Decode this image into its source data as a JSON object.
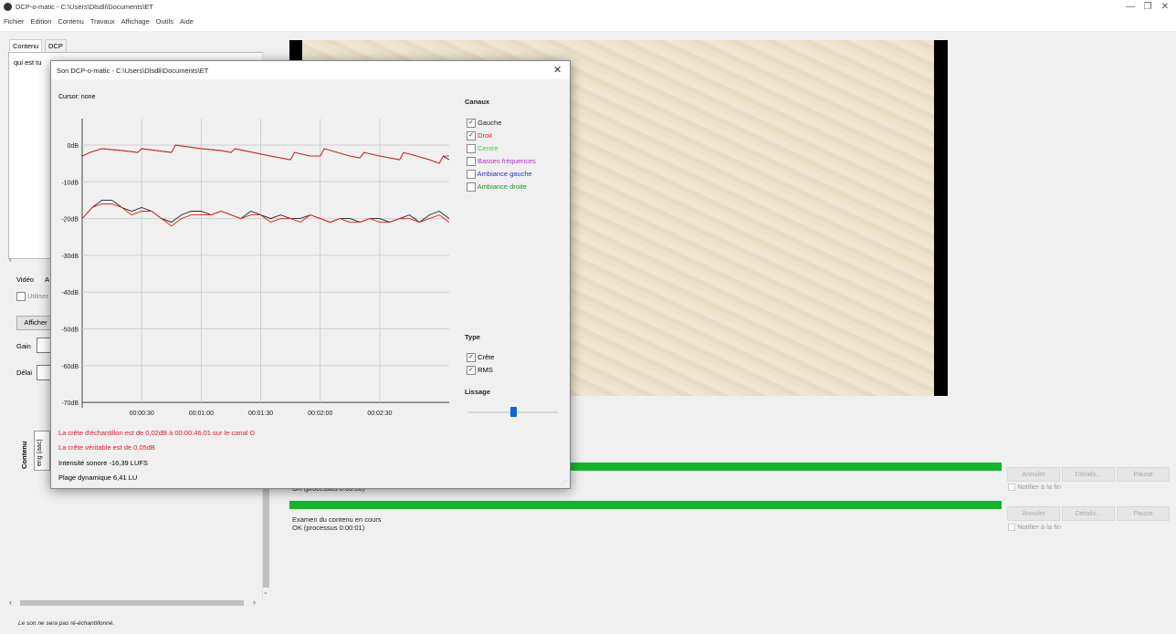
{
  "window": {
    "title": "DCP-o-matic - C:\\Users\\Dlsdli\\Documents\\ET",
    "min": "—",
    "restore": "❐",
    "close": "✕"
  },
  "menu": [
    "Fichier",
    "Edition",
    "Contenu",
    "Travaux",
    "Affichage",
    "Outils",
    "Aide"
  ],
  "left": {
    "tabs": [
      "Contenu",
      "DCP"
    ],
    "content_item": "qui est tu",
    "lower_tabs": [
      "Vidéo",
      "A"
    ],
    "use_label": "Utiliser",
    "show_button": "Afficher",
    "gain_label": "Gain",
    "delay_label": "Délai",
    "vertical_label": "Contenu",
    "track_label": "eng (aac)",
    "footer_note": "Le son ne sera pas ré-échantillonné."
  },
  "jobs": [
    {
      "status": "OK (processus 0:00:50)",
      "cancel": "Annuler",
      "details": "Détails...",
      "pause": "Pause",
      "notify": "Notifier à la fin",
      "progress": 1.0
    },
    {
      "name": "Examen du contenu en cours",
      "status": "OK (processus 0:00:01)",
      "cancel": "Annuler",
      "details": "Détails...",
      "pause": "Pause",
      "notify": "Notifier à la fin",
      "progress": 1.0
    }
  ],
  "dialog": {
    "title": "Son DCP-o-matic - C:\\Users\\Dlsdli\\Documents\\ET",
    "close": "✕",
    "cursor": "Cursor: none",
    "channels_heading": "Canaux",
    "channels": [
      {
        "label": "Gauche",
        "checked": true,
        "color": "#222222"
      },
      {
        "label": "Droit",
        "checked": true,
        "color": "#e02020"
      },
      {
        "label": "Centre",
        "checked": false,
        "color": "#33dd33"
      },
      {
        "label": "Basses fréquences",
        "checked": false,
        "color": "#b030d0"
      },
      {
        "label": "Ambiance gauche",
        "checked": false,
        "color": "#3030d0"
      },
      {
        "label": "Ambiance droite",
        "checked": false,
        "color": "#209020"
      }
    ],
    "type_heading": "Type",
    "types": [
      {
        "label": "Crête",
        "checked": true
      },
      {
        "label": "RMS",
        "checked": true
      }
    ],
    "smoothing_heading": "Lissage",
    "smoothing_value": 0.5,
    "stats": {
      "sample_peak": "La crête d'échantillon est de 0,02dB à 00:00:46.01 sur le canal G",
      "true_peak": "La crête véritable est de 0,05dB",
      "loudness": "Intensité sonore -16,39 LUFS",
      "range": "Plage dynamique 6,41 LU"
    }
  },
  "chart_data": {
    "type": "line",
    "y_ticks": [
      "0dB",
      "-10dB",
      "-20dB",
      "-30dB",
      "-40dB",
      "-50dB",
      "-60dB",
      "-70dB"
    ],
    "x_ticks": [
      "00:00:30",
      "00:01:00",
      "00:01:30",
      "00:02:00",
      "00:02:30"
    ],
    "ylim": [
      -70,
      10
    ],
    "grid": true,
    "series": [
      {
        "name": "Gauche",
        "kind": "peak",
        "color": "#222222",
        "x": [
          0,
          4,
          10,
          20,
          28,
          30,
          45,
          47,
          60,
          70,
          75,
          77,
          95,
          105,
          107,
          115,
          120,
          122,
          135,
          140,
          142,
          150,
          160,
          162,
          175,
          180,
          182,
          185
        ],
        "y": [
          -3,
          -2,
          -1,
          -1.5,
          -2,
          -1,
          -2,
          0,
          -1,
          -1.5,
          -2,
          -1,
          -3,
          -4,
          -2,
          -3,
          -3,
          -1,
          -3,
          -3.5,
          -2,
          -3,
          -4,
          -2,
          -4,
          -5,
          -3,
          -4
        ]
      },
      {
        "name": "Droit",
        "kind": "peak",
        "color": "#e02020",
        "x": [
          0,
          4,
          10,
          20,
          28,
          30,
          45,
          47,
          60,
          70,
          75,
          77,
          95,
          105,
          107,
          115,
          120,
          122,
          135,
          140,
          142,
          150,
          160,
          162,
          175,
          180,
          182,
          185
        ],
        "y": [
          -3,
          -2,
          -1,
          -1.5,
          -2,
          -1,
          -2,
          0,
          -1,
          -1.5,
          -2,
          -1,
          -3,
          -4,
          -2,
          -3,
          -3,
          -1,
          -3,
          -3.5,
          -2,
          -3,
          -4,
          -2,
          -4,
          -5,
          -3,
          -3
        ]
      },
      {
        "name": "Gauche",
        "kind": "rms",
        "color": "#222222",
        "x": [
          0,
          5,
          10,
          15,
          20,
          25,
          30,
          35,
          40,
          45,
          50,
          55,
          60,
          65,
          70,
          75,
          80,
          85,
          90,
          95,
          100,
          105,
          110,
          115,
          120,
          125,
          130,
          135,
          140,
          145,
          150,
          155,
          160,
          165,
          170,
          175,
          180,
          185
        ],
        "y": [
          -20,
          -17,
          -15,
          -15,
          -17,
          -18,
          -17,
          -18,
          -20,
          -21,
          -19,
          -18,
          -18,
          -19,
          -18,
          -19,
          -20,
          -18,
          -19,
          -20,
          -19,
          -20,
          -20,
          -19,
          -20,
          -21,
          -20,
          -20,
          -21,
          -20,
          -20,
          -21,
          -20,
          -19,
          -21,
          -19,
          -18,
          -20
        ]
      },
      {
        "name": "Droit",
        "kind": "rms",
        "color": "#e02020",
        "x": [
          0,
          5,
          10,
          15,
          20,
          25,
          30,
          35,
          40,
          45,
          50,
          55,
          60,
          65,
          70,
          75,
          80,
          85,
          90,
          95,
          100,
          105,
          110,
          115,
          120,
          125,
          130,
          135,
          140,
          145,
          150,
          155,
          160,
          165,
          170,
          175,
          180,
          185
        ],
        "y": [
          -20,
          -17,
          -16,
          -16,
          -17,
          -19,
          -18,
          -18,
          -20,
          -22,
          -20,
          -19,
          -19,
          -19,
          -18,
          -19,
          -20,
          -19,
          -19,
          -21,
          -20,
          -20,
          -21,
          -19,
          -20,
          -21,
          -20,
          -21,
          -21,
          -20,
          -21,
          -21,
          -20,
          -20,
          -21,
          -20,
          -19,
          -21
        ]
      }
    ]
  }
}
